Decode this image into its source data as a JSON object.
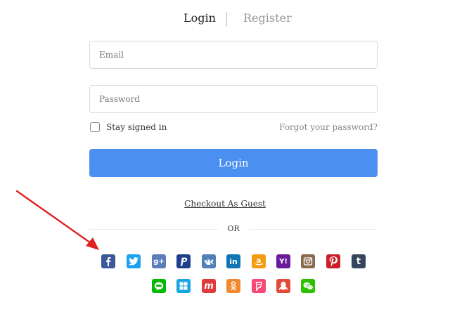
{
  "tabs": {
    "login": "Login",
    "register": "Register"
  },
  "form": {
    "email_placeholder": "Email",
    "password_placeholder": "Password",
    "remember_label": "Stay signed in",
    "remember_checked": false,
    "forgot_label": "Forgot your password?",
    "login_button": "Login",
    "guest_link": "Checkout As Guest",
    "divider_text": "OR"
  },
  "colors": {
    "primary": "#4b8ff0"
  },
  "social_icons": [
    {
      "name": "facebook-icon",
      "color": "#3b5998",
      "glyph": "f"
    },
    {
      "name": "twitter-icon",
      "color": "#1da1f2",
      "glyph": "bird"
    },
    {
      "name": "google-plus-icon",
      "color": "#5b7db8",
      "glyph": "g+"
    },
    {
      "name": "paypal-icon",
      "color": "#1d3f8c",
      "glyph": "P"
    },
    {
      "name": "vk-icon",
      "color": "#5181b8",
      "glyph": "vk"
    },
    {
      "name": "linkedin-icon",
      "color": "#1176b3",
      "glyph": "in"
    },
    {
      "name": "amazon-icon",
      "color": "#f39c12",
      "glyph": "a"
    },
    {
      "name": "yahoo-icon",
      "color": "#6a1b9a",
      "glyph": "Y!"
    },
    {
      "name": "instagram-icon",
      "color": "#8a6a4f",
      "glyph": "cam"
    },
    {
      "name": "pinterest-icon",
      "color": "#cb2027",
      "glyph": "P"
    },
    {
      "name": "tumblr-icon",
      "color": "#35465c",
      "glyph": "t"
    },
    {
      "name": "line-icon",
      "color": "#00b900",
      "glyph": "line"
    },
    {
      "name": "windows-icon",
      "color": "#1aa7e0",
      "glyph": "win"
    },
    {
      "name": "meetup-icon",
      "color": "#e0393e",
      "glyph": "m"
    },
    {
      "name": "odnoklassniki-icon",
      "color": "#f0892f",
      "glyph": "ok"
    },
    {
      "name": "foursquare-icon",
      "color": "#f94877",
      "glyph": "fs"
    },
    {
      "name": "qq-icon",
      "color": "#e24a3b",
      "glyph": "qq"
    },
    {
      "name": "wechat-icon",
      "color": "#2dc100",
      "glyph": "wc"
    }
  ]
}
